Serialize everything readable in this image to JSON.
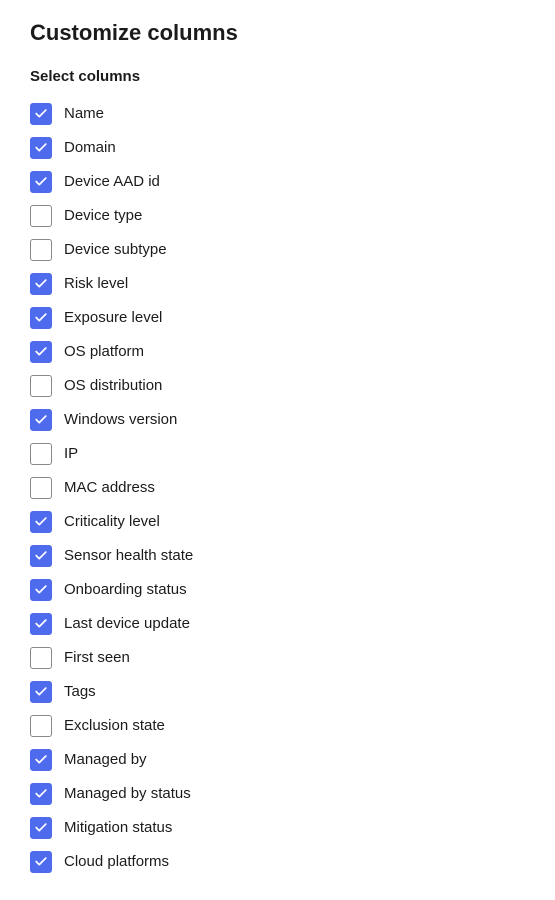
{
  "title": "Customize columns",
  "section_label": "Select columns",
  "columns": [
    {
      "id": "name",
      "label": "Name",
      "checked": true
    },
    {
      "id": "domain",
      "label": "Domain",
      "checked": true
    },
    {
      "id": "device-aad-id",
      "label": "Device AAD id",
      "checked": true
    },
    {
      "id": "device-type",
      "label": "Device type",
      "checked": false
    },
    {
      "id": "device-subtype",
      "label": "Device subtype",
      "checked": false
    },
    {
      "id": "risk-level",
      "label": "Risk level",
      "checked": true
    },
    {
      "id": "exposure-level",
      "label": "Exposure level",
      "checked": true
    },
    {
      "id": "os-platform",
      "label": "OS platform",
      "checked": true
    },
    {
      "id": "os-distribution",
      "label": "OS distribution",
      "checked": false
    },
    {
      "id": "windows-version",
      "label": "Windows version",
      "checked": true
    },
    {
      "id": "ip",
      "label": "IP",
      "checked": false
    },
    {
      "id": "mac-address",
      "label": "MAC address",
      "checked": false
    },
    {
      "id": "criticality-level",
      "label": "Criticality level",
      "checked": true
    },
    {
      "id": "sensor-health-state",
      "label": "Sensor health state",
      "checked": true
    },
    {
      "id": "onboarding-status",
      "label": "Onboarding status",
      "checked": true
    },
    {
      "id": "last-device-update",
      "label": "Last device update",
      "checked": true
    },
    {
      "id": "first-seen",
      "label": "First seen",
      "checked": false
    },
    {
      "id": "tags",
      "label": "Tags",
      "checked": true
    },
    {
      "id": "exclusion-state",
      "label": "Exclusion state",
      "checked": false
    },
    {
      "id": "managed-by",
      "label": "Managed by",
      "checked": true
    },
    {
      "id": "managed-by-status",
      "label": "Managed by status",
      "checked": true
    },
    {
      "id": "mitigation-status",
      "label": "Mitigation status",
      "checked": true
    },
    {
      "id": "cloud-platforms",
      "label": "Cloud platforms",
      "checked": true
    }
  ]
}
